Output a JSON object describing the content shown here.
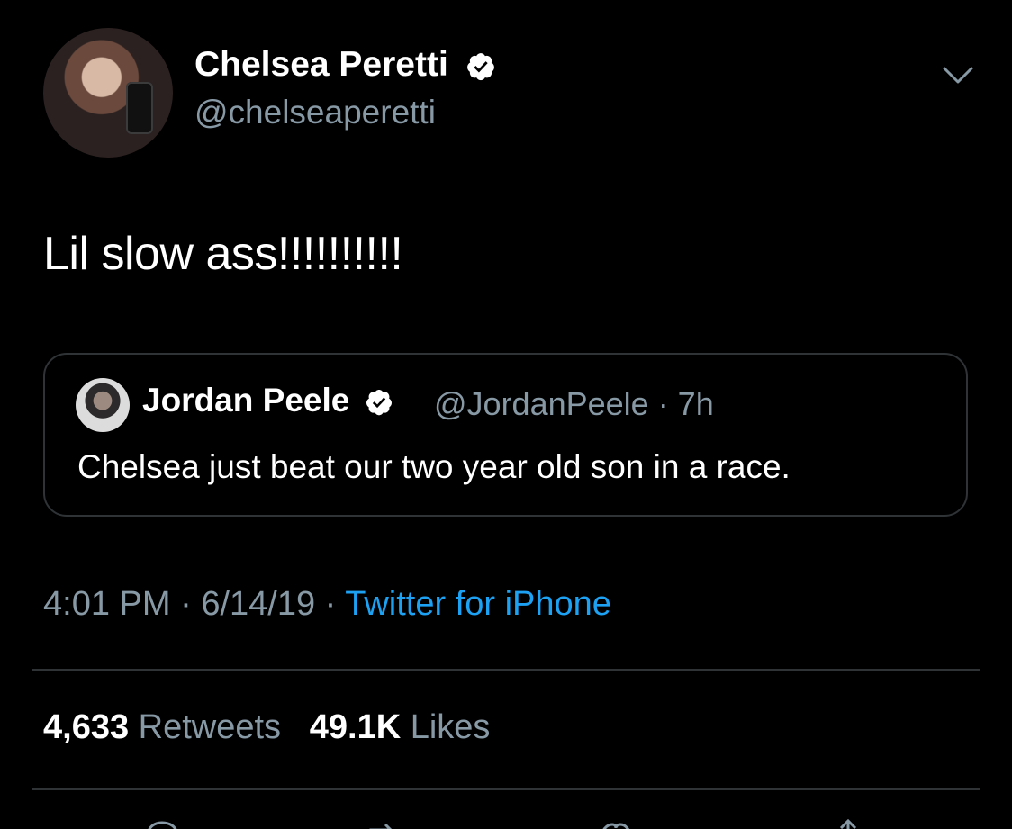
{
  "author": {
    "display_name": "Chelsea Peretti",
    "handle": "@chelseaperetti"
  },
  "tweet": {
    "text": "Lil slow ass!!!!!!!!!!"
  },
  "quoted_tweet": {
    "display_name": "Jordan Peele",
    "handle_time": "@JordanPeele · 7h",
    "text": "Chelsea just beat our two year old son in a race."
  },
  "meta": {
    "time": "4:01 PM",
    "date": "6/14/19",
    "separator": " · ",
    "source": "Twitter for iPhone"
  },
  "stats": {
    "retweets_count": "4,633",
    "retweets_label": "Retweets",
    "likes_count": "49.1K",
    "likes_label": "Likes"
  },
  "icons": {
    "verified": "verified-badge-icon",
    "menu": "chevron-down-icon",
    "reply": "reply-icon",
    "retweet": "retweet-icon",
    "like": "heart-icon",
    "share": "share-icon"
  },
  "colors": {
    "background": "#000000",
    "text": "#ffffff",
    "secondary": "#8899a6",
    "link": "#1da1f2",
    "border": "#2f3336"
  }
}
